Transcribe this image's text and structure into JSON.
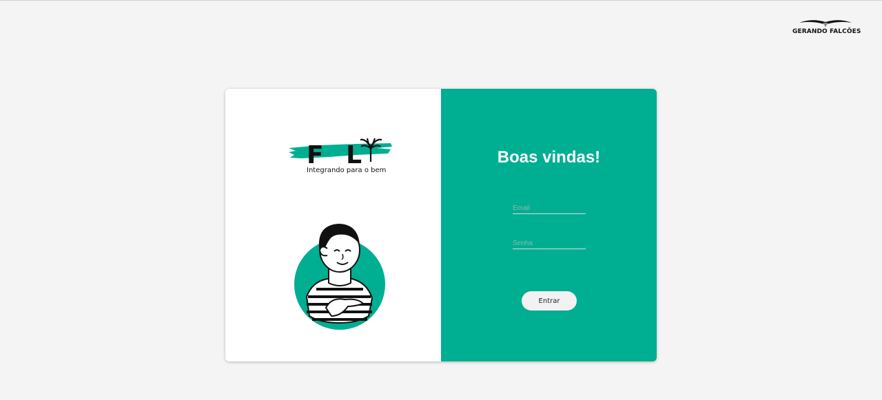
{
  "brand": {
    "name": "GERANDO FALCÕES",
    "icon": "falcon-wings-icon"
  },
  "logo": {
    "letters": "F L",
    "tagline": "Integrando para o bem",
    "accent": "#00ae92"
  },
  "form": {
    "title": "Boas vindas!",
    "email_placeholder": "Email",
    "password_placeholder": "Senha",
    "submit_label": "Entrar"
  },
  "colors": {
    "primary": "#00ae92",
    "background": "#f4f4f4",
    "card_left": "#ffffff"
  }
}
